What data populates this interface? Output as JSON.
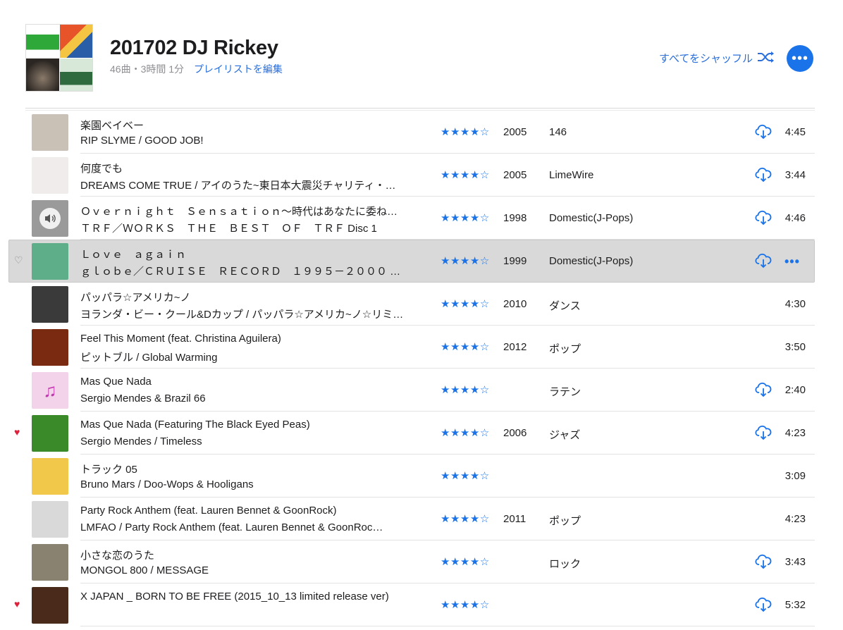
{
  "header": {
    "title": "201702 DJ Rickey",
    "meta": "46曲・3時間 1分",
    "edit_label": "プレイリストを編集",
    "shuffle_label": "すべてをシャッフル",
    "more_label": "•••"
  },
  "colors": {
    "accent": "#1a73e8",
    "heart": "#e0203a",
    "selected_row": "#d9d9d9"
  },
  "tracks": [
    {
      "title": "楽園ベイベー",
      "subtitle": "RIP SLYME / GOOD JOB!",
      "stars": "★★★★☆",
      "year": "2005",
      "genre": "146",
      "download": true,
      "duration": "4:45",
      "heart": "none",
      "art": "#c9c0b6"
    },
    {
      "title": "何度でも",
      "subtitle": "DREAMS COME TRUE / アイのうた~東日本大震災チャリティ・ア…",
      "stars": "★★★★☆",
      "year": "2005",
      "genre": "LimeWire",
      "download": true,
      "duration": "3:44",
      "heart": "none",
      "art": "#f1ecec"
    },
    {
      "title": "Ｏｖｅｒｎｉｇｈｔ　Ｓｅｎｓａｔｉｏｎ～時代はあなたに委ねて…",
      "subtitle": "ＴＲＦ／ＷＯＲＫＳ　ＴＨＥ　ＢＥＳＴ　ＯＦ　ＴＲＦ Disc 1",
      "stars": "★★★★☆",
      "year": "1998",
      "genre": "Domestic(J-Pops)",
      "download": true,
      "duration": "4:46",
      "heart": "none",
      "art": "#9a9a9a",
      "playing": true
    },
    {
      "title": "Ｌｏｖｅ　ａｇａｉｎ",
      "subtitle": "ｇｌｏｂｅ／ＣＲＵＩＳＥ　ＲＥＣＯＲＤ　１９９５－２０００ Dis…",
      "stars": "★★★★☆",
      "year": "1999",
      "genre": "Domestic(J-Pops)",
      "download": true,
      "duration": "",
      "heart": "outline",
      "art": "#5fae8a",
      "selected": true
    },
    {
      "title": "パッパラ☆アメリカ~ノ",
      "subtitle": "ヨランダ・ビー・クール&Dカップ / パッパラ☆アメリカ~ノ☆リミキ…",
      "stars": "★★★★☆",
      "year": "2010",
      "genre": "ダンス",
      "download": false,
      "duration": "4:30",
      "heart": "none",
      "art": "#3a3a3a"
    },
    {
      "title": "Feel This Moment (feat. Christina Aguilera)",
      "subtitle": "ピットブル / Global Warming",
      "stars": "★★★★☆",
      "year": "2012",
      "genre": "ポップ",
      "download": false,
      "duration": "3:50",
      "heart": "none",
      "art": "#7a2a10"
    },
    {
      "title": "Mas Que Nada",
      "subtitle": "Sergio Mendes & Brazil 66",
      "stars": "★★★★☆",
      "year": "",
      "genre": "ラテン",
      "download": true,
      "duration": "2:40",
      "heart": "none",
      "art": "#f3d3ea",
      "note": "♫"
    },
    {
      "title": "Mas Que Nada (Featuring The Black Eyed Peas)",
      "subtitle": "Sergio Mendes / Timeless",
      "stars": "★★★★☆",
      "year": "2006",
      "genre": "ジャズ",
      "download": true,
      "duration": "4:23",
      "heart": "filled",
      "art": "#3a8a2a"
    },
    {
      "title": "トラック 05",
      "subtitle": "Bruno Mars / Doo-Wops & Hooligans",
      "stars": "★★★★☆",
      "year": "",
      "genre": "",
      "download": false,
      "duration": "3:09",
      "heart": "none",
      "art": "#f2c84a"
    },
    {
      "title": "Party Rock Anthem (feat. Lauren Bennet & GoonRock)",
      "subtitle": "LMFAO / Party Rock Anthem (feat. Lauren Bennet & GoonRoc…",
      "stars": "★★★★☆",
      "year": "2011",
      "genre": "ポップ",
      "download": false,
      "duration": "4:23",
      "heart": "none",
      "art": "#d9d9d9"
    },
    {
      "title": "小さな恋のうた",
      "subtitle": "MONGOL 800 / MESSAGE",
      "stars": "★★★★☆",
      "year": "",
      "genre": "ロック",
      "download": true,
      "duration": "3:43",
      "heart": "none",
      "art": "#8a8270"
    },
    {
      "title": "X JAPAN _ BORN TO BE FREE (2015_10_13 limited release ver)",
      "subtitle": "",
      "stars": "★★★★☆",
      "year": "",
      "genre": "",
      "download": true,
      "duration": "5:32",
      "heart": "filled",
      "art": "#4a2a1a"
    }
  ]
}
